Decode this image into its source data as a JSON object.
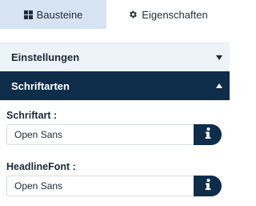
{
  "tabs": {
    "bausteine": {
      "label": "Bausteine",
      "icon": "grid-icon"
    },
    "eigenschaften": {
      "label": "Eigenschaften",
      "icon": "gear-icon"
    }
  },
  "sections": {
    "einstellungen": {
      "label": "Einstellungen",
      "state": "collapsed"
    },
    "schriftarten": {
      "label": "Schriftarten",
      "state": "expanded"
    }
  },
  "fields": {
    "schriftart": {
      "label": "Schriftart :",
      "value": "Open Sans"
    },
    "headline_font": {
      "label": "HeadlineFont :",
      "value": "Open Sans"
    }
  },
  "colors": {
    "active_tab_bg": "#d5e3f2",
    "navy": "#0d2d4a",
    "section_bg": "#eef3f9"
  }
}
